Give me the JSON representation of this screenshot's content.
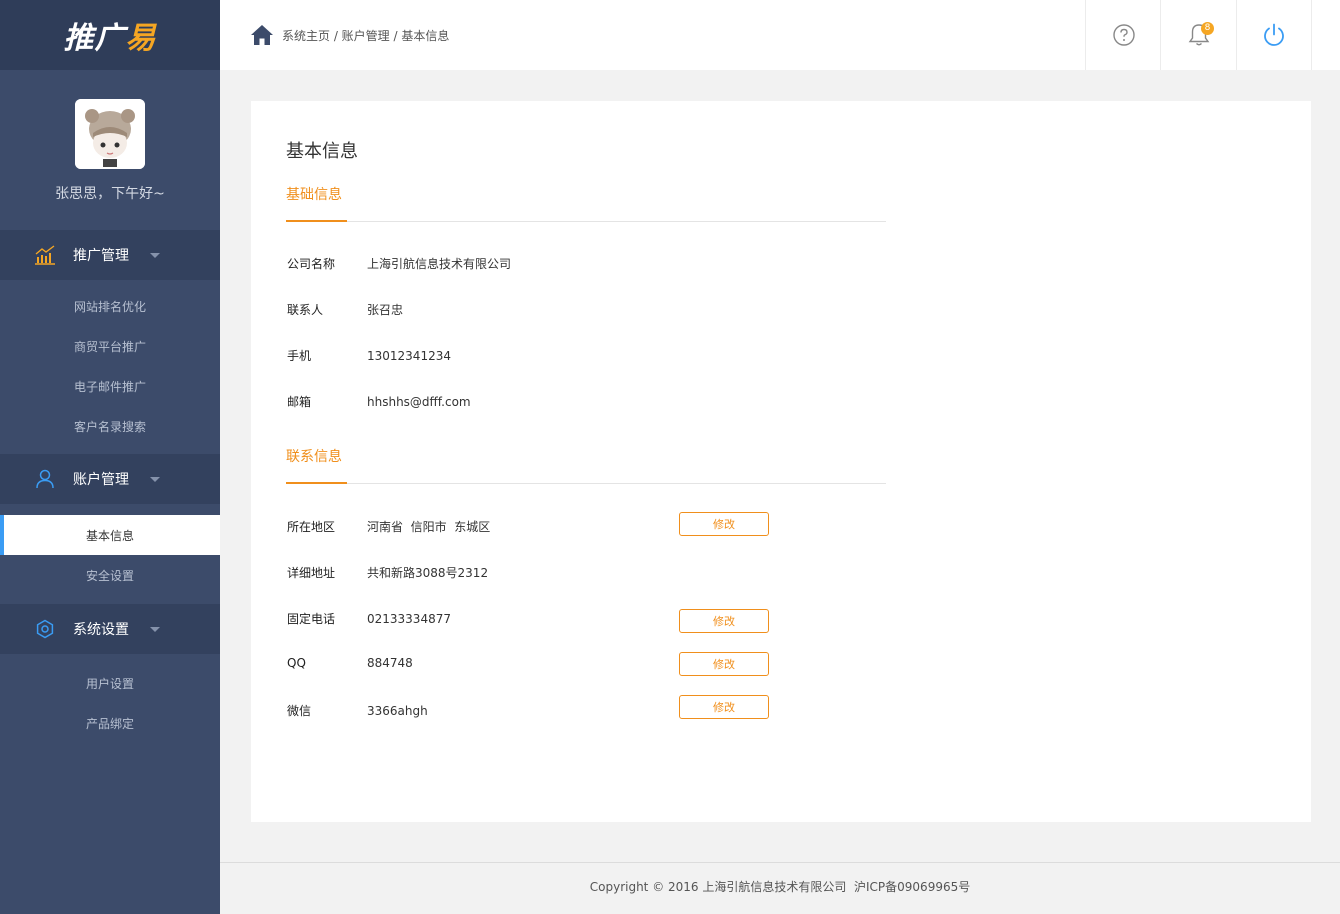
{
  "brand": {
    "logo_main": "推广",
    "logo_accent": "易"
  },
  "profile": {
    "greeting": "张思思，下午好~"
  },
  "sidebar": {
    "groups": [
      {
        "label": "推广管理",
        "icon": "chart-icon",
        "items": [
          "网站排名优化",
          "商贸平台推广",
          "电子邮件推广",
          "客户名录搜索"
        ]
      },
      {
        "label": "账户管理",
        "icon": "user-icon",
        "items": [
          "基本信息",
          "安全设置"
        ],
        "active": "基本信息"
      },
      {
        "label": "系统设置",
        "icon": "settings-icon",
        "items": [
          "用户设置",
          "产品绑定"
        ]
      }
    ]
  },
  "header": {
    "breadcrumb": "系统主页 / 账户管理 / 基本信息",
    "notification_count": "8",
    "icons": [
      "help-icon",
      "bell-icon",
      "power-icon"
    ]
  },
  "main": {
    "page_title": "基本信息",
    "basic_section": {
      "title": "基础信息",
      "rows": [
        {
          "label": "公司名称",
          "value": "上海引航信息技术有限公司"
        },
        {
          "label": "联系人",
          "value": "张召忠"
        },
        {
          "label": "手机",
          "value": "13012341234"
        },
        {
          "label": "邮箱",
          "value": "hhshhs@dfff.com"
        }
      ]
    },
    "contact_section": {
      "title": "联系信息",
      "rows": [
        {
          "label": "所在地区",
          "value": "河南省  信阳市  东城区",
          "button": "修改"
        },
        {
          "label": "详细地址",
          "value": "共和新路3088号2312"
        },
        {
          "label": "固定电话",
          "value": "02133334877",
          "button": "修改"
        },
        {
          "label": "QQ",
          "value": "884748",
          "button": "修改"
        },
        {
          "label": "微信",
          "value": "3366ahgh",
          "button": "修改"
        }
      ]
    }
  },
  "footer": {
    "text": "Copyright © 2016 上海引航信息技术有限公司  沪ICP备09069965号"
  },
  "colors": {
    "sidebar": "#3c4b6a",
    "accent": "#f08f1c",
    "active_indicator": "#3a9cf4"
  }
}
